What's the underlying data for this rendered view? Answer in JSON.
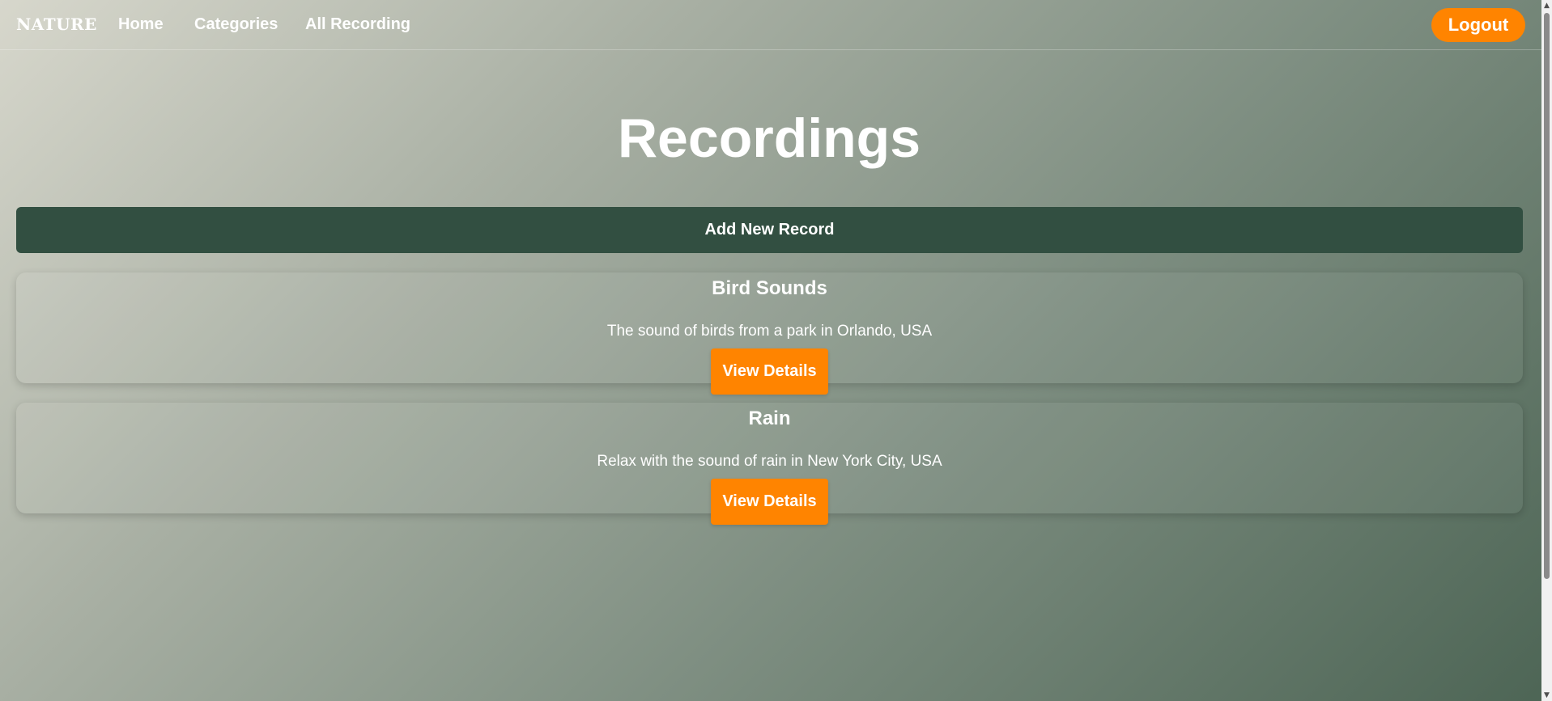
{
  "navbar": {
    "brand": "NATURE",
    "links": [
      "Home",
      "Categories",
      "All Recording"
    ],
    "logout_label": "Logout"
  },
  "main": {
    "title": "Recordings",
    "add_button_label": "Add New Record",
    "recordings": [
      {
        "title": "Bird Sounds",
        "description": "The sound of birds from a park in Orlando, USA",
        "button_label": "View Details"
      },
      {
        "title": "Rain",
        "description": "Relax with the sound of rain in New York City, USA",
        "button_label": "View Details"
      }
    ]
  },
  "colors": {
    "accent_orange": "#ff8400",
    "dark_green": "#324f41"
  },
  "scrollbar": {
    "up_icon": "▲",
    "down_icon": "▼"
  }
}
